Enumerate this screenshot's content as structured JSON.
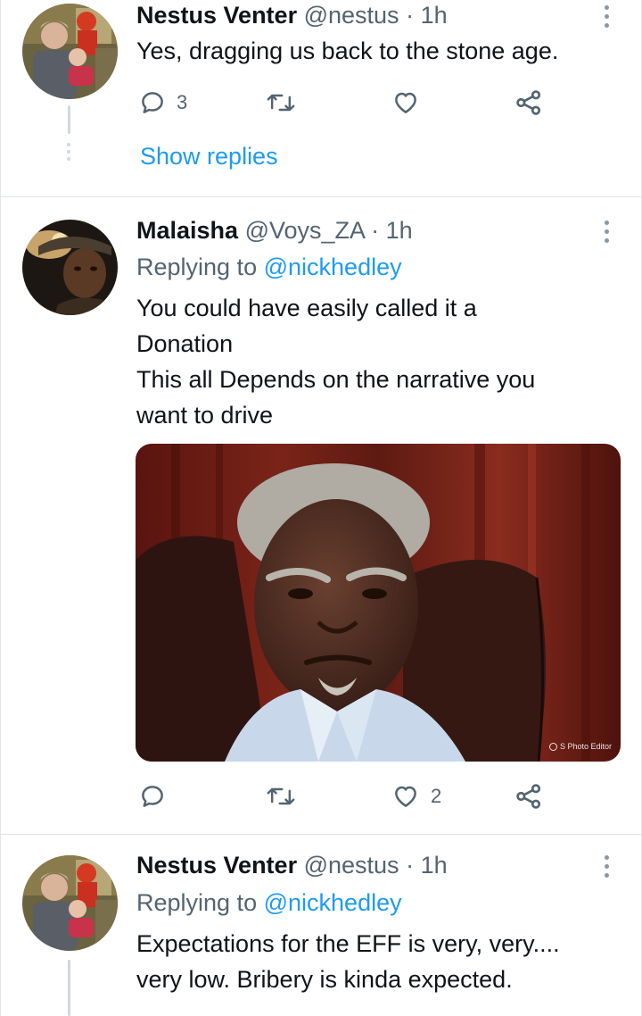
{
  "tweets": [
    {
      "name": "Nestus Venter",
      "handle": "@nestus",
      "separator": "·",
      "time": "1h",
      "lines": [
        "Yes, dragging us back to the stone age."
      ],
      "reply_count": "3",
      "show_replies": "Show replies"
    },
    {
      "name": "Malaisha",
      "handle": "@Voys_ZA",
      "separator": "·",
      "time": "1h",
      "replying_prefix": "Replying to",
      "replying_mention": "@nickhedley",
      "lines": [
        "You could have easily called it a",
        "Donation",
        "This all Depends on the narrative you",
        "want to drive"
      ],
      "like_count": "2",
      "media_watermark": "S Photo Editor"
    },
    {
      "name": "Nestus Venter",
      "handle": "@nestus",
      "separator": "·",
      "time": "1h",
      "replying_prefix": "Replying to",
      "replying_mention": "@nickhedley",
      "lines": [
        "Expectations for the EFF is very, very....",
        "very low. Bribery is kinda expected."
      ]
    }
  ],
  "colors": {
    "link": "#1d9bf0",
    "secondary_text": "#536471",
    "icon": "#536471",
    "thread_line": "#cfd9de"
  },
  "icons": {
    "reply": "reply-icon",
    "retweet": "retweet-icon",
    "like": "like-icon",
    "share": "share-icon",
    "more": "more-options-icon"
  }
}
